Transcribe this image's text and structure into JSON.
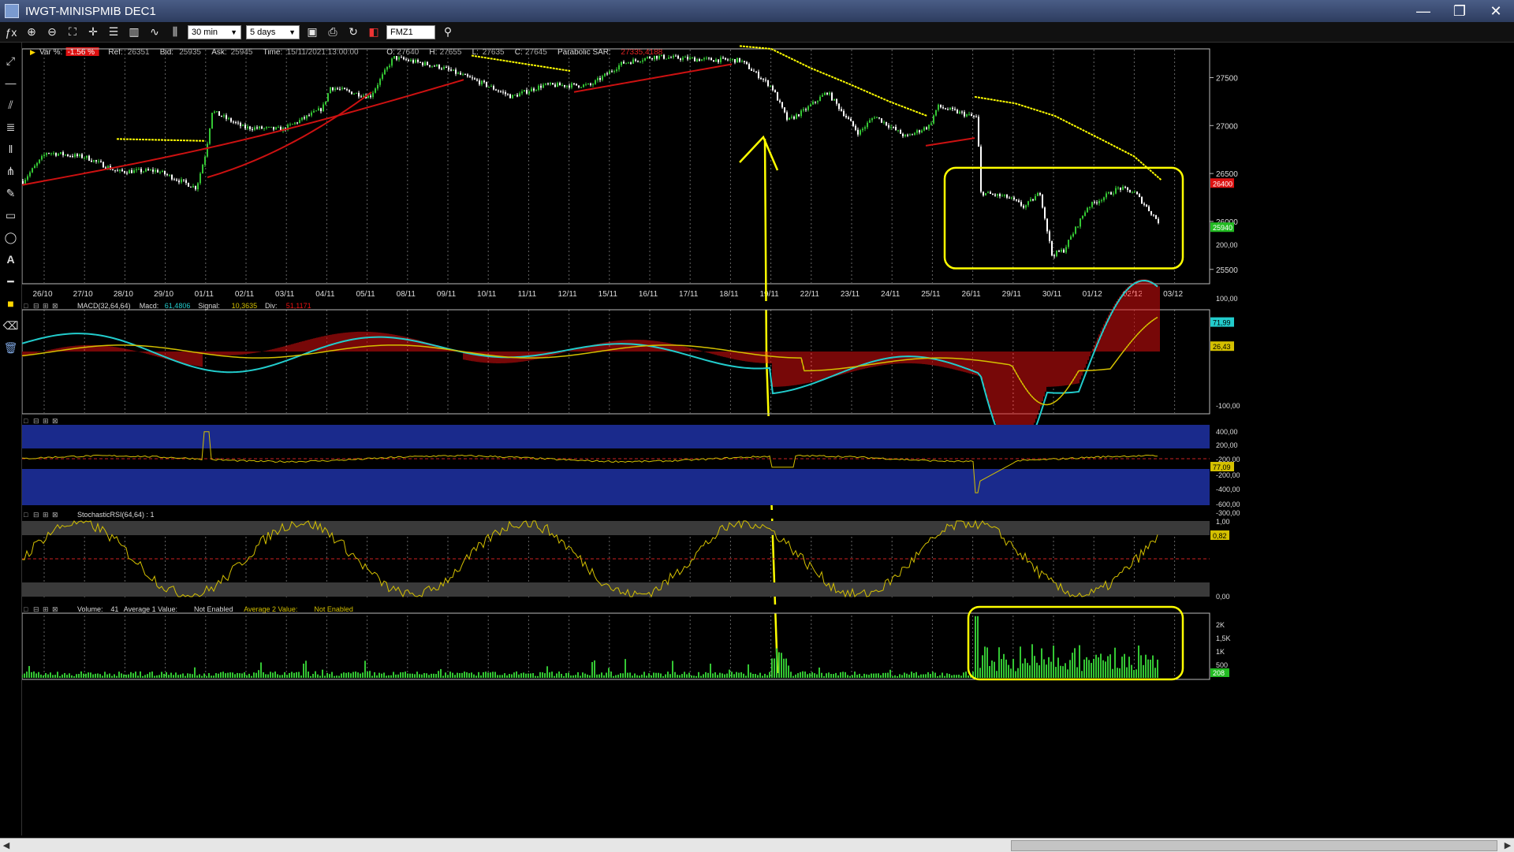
{
  "window": {
    "title": "IWGT-MINISPMIB DEC1",
    "minimize": "—",
    "maximize": "❐",
    "close": "✕"
  },
  "toolbar": {
    "fx_label": "ƒx",
    "timeframe": "30 min",
    "range": "5 days",
    "symbol": "FMZ1"
  },
  "icons": [
    "fx-icon",
    "zoom-in-icon",
    "zoom-out-icon",
    "zoom-fit-icon",
    "crosshair-icon",
    "list-icon",
    "bar-chart-icon",
    "line-chart-icon",
    "candle-icon",
    "save-icon",
    "print-icon",
    "color-icon",
    "search-icon"
  ],
  "left_tools": [
    "trendline-icon",
    "horizontal-line-icon",
    "channel-icon",
    "fibonacci-icon",
    "vertical-lines-icon",
    "pitchfork-icon",
    "pen-icon",
    "rectangle-icon",
    "ellipse-icon",
    "text-icon",
    "line-width-icon",
    "color-swatch-icon",
    "eraser-icon",
    "trash-icon"
  ],
  "price_info": {
    "var_label": "Var %:",
    "var_value": "-1.56 %",
    "ref_label": "Ref:",
    "ref_value": "26351",
    "bid_label": "Bid:",
    "bid_value": "25935",
    "ask_label": "Ask:",
    "ask_value": "25945",
    "time_label": "Time:",
    "time_value": "15/11/2021 13:00:00",
    "open_label": "O:",
    "open_value": "27640",
    "high_label": "H:",
    "high_value": "27655",
    "low_label": "L:",
    "low_value": "27635",
    "close_label": "C:",
    "close_value": "27645",
    "sar_label": "Parabolic SAR:",
    "sar_value": "27335,4188"
  },
  "price_axis": {
    "ticks": [
      "27500",
      "27000",
      "26500",
      "26000",
      "25500"
    ],
    "last_price_badge": "26400",
    "bid_badge": "25940"
  },
  "dates": [
    "26/10",
    "27/10",
    "28/10",
    "29/10",
    "01/11",
    "02/11",
    "03/11",
    "04/11",
    "05/11",
    "08/11",
    "09/11",
    "10/11",
    "11/11",
    "12/11",
    "15/11",
    "16/11",
    "17/11",
    "18/11",
    "19/11",
    "22/11",
    "23/11",
    "24/11",
    "25/11",
    "26/11",
    "29/11",
    "30/11",
    "01/12",
    "02/12",
    "03/12"
  ],
  "macd": {
    "label": "MACD(32,64,64)",
    "macd_label": "Macd:",
    "macd_value": "61,4806",
    "signal_label": "Signal:",
    "signal_value": "10,3635",
    "div_label": "Div:",
    "div_value": "51,1171",
    "ticks": [
      "200,00",
      "100,00",
      "-100,00",
      "-200,00",
      "-300,00"
    ],
    "macd_badge": "71,99",
    "signal_badge": "26,43"
  },
  "oscillator": {
    "ticks": [
      "400,00",
      "200,00",
      "-200,00",
      "-400,00",
      "-600,00"
    ],
    "value_badge": "77,09"
  },
  "stoch": {
    "label": "StochasticRSI(64,64) : 1",
    "ticks": [
      "1,00",
      "0,00"
    ],
    "value_badge": "0,82"
  },
  "volume": {
    "label": "Volume:",
    "value": "41",
    "avg1_label": "Average 1 Value:",
    "avg1_value": "Not Enabled",
    "avg2_label": "Average 2 Value:",
    "avg2_value": "Not Enabled",
    "ticks": [
      "2K",
      "1,5K",
      "1K",
      "500"
    ],
    "value_badge": "208"
  },
  "colors": {
    "bg": "#000000",
    "price_up": "#34c734",
    "sar": "#cc1111",
    "annotation": "#ffff00",
    "macd_line": "#22cccc",
    "signal_line": "#d4c000",
    "histogram": "#ee1111",
    "osc_band": "#1a2a8c"
  }
}
